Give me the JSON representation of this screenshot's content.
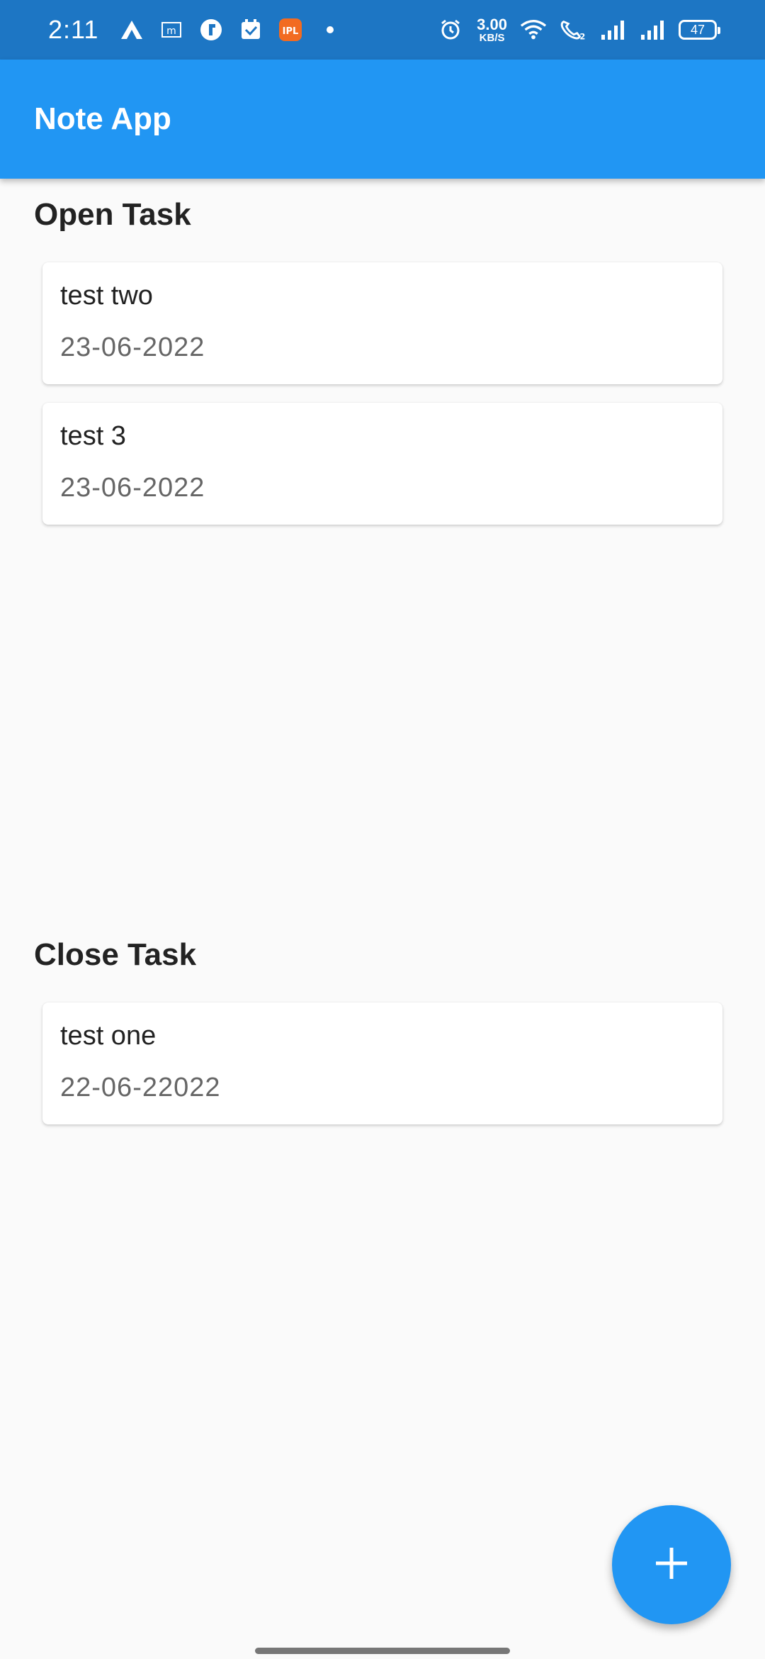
{
  "status_bar": {
    "time": "2:11",
    "network_speed_value": "3.00",
    "network_speed_unit": "KB/S",
    "battery": "47",
    "left_icons": [
      "app-a-icon",
      "m-icon",
      "f-icon",
      "calendar-icon",
      "ipl-icon",
      "dot-icon"
    ],
    "right_icons": [
      "alarm-icon",
      "wifi-icon",
      "call-icon",
      "signal-icon",
      "signal-icon",
      "battery-icon"
    ]
  },
  "app_bar": {
    "title": "Note App"
  },
  "open_section": {
    "title": "Open Task",
    "tasks": [
      {
        "title": "test two",
        "date": "23-06-2022"
      },
      {
        "title": "test 3",
        "date": "23-06-2022"
      }
    ]
  },
  "close_section": {
    "title": "Close Task",
    "tasks": [
      {
        "title": "test one",
        "date": "22-06-22022"
      }
    ]
  },
  "fab": {
    "icon": "plus-icon"
  },
  "colors": {
    "primary": "#2196f3",
    "status_bar": "#1d76c4",
    "background": "#fafafa"
  }
}
